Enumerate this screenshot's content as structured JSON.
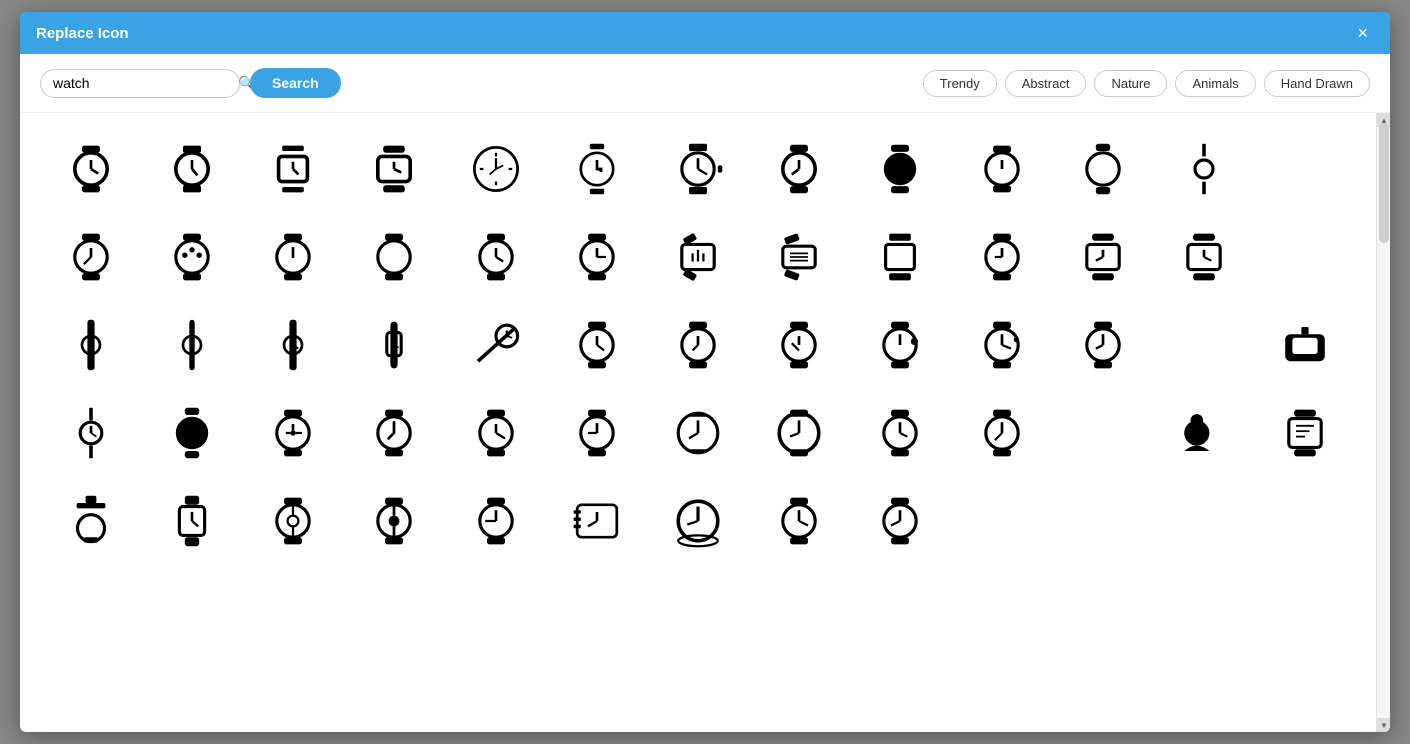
{
  "modal": {
    "title": "Replace Icon",
    "close_label": "×"
  },
  "toolbar": {
    "search_value": "watch",
    "search_placeholder": "watch",
    "search_button_label": "Search",
    "search_icon": "🔍"
  },
  "filters": [
    {
      "label": "Trendy",
      "id": "trendy"
    },
    {
      "label": "Abstract",
      "id": "abstract"
    },
    {
      "label": "Nature",
      "id": "nature"
    },
    {
      "label": "Animals",
      "id": "animals"
    },
    {
      "label": "Hand Drawn",
      "id": "hand-drawn"
    }
  ],
  "colors": {
    "header_bg": "#3aa3e3",
    "search_btn_bg": "#3aa3e3"
  }
}
